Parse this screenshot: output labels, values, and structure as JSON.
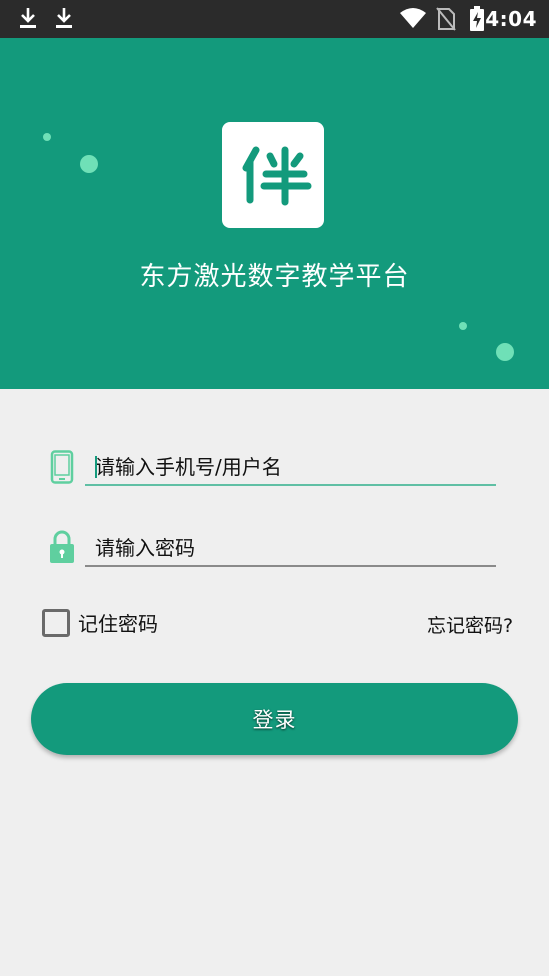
{
  "status_bar": {
    "time": "4:04",
    "icons": [
      "download-icon",
      "download-icon",
      "wifi-icon",
      "no-sim-icon",
      "battery-charging-icon"
    ]
  },
  "header": {
    "logo_char": "伴",
    "app_title": "东方激光数字教学平台"
  },
  "form": {
    "phone_placeholder": "请输入手机号/用户名",
    "password_placeholder": "请输入密码",
    "remember_label": "记住密码",
    "forgot_label": "忘记密码?",
    "login_label": "登录"
  },
  "colors": {
    "accent": "#139a7c",
    "dot": "#6fe0b7",
    "icon": "#5fcf9f",
    "background": "#efefef"
  }
}
